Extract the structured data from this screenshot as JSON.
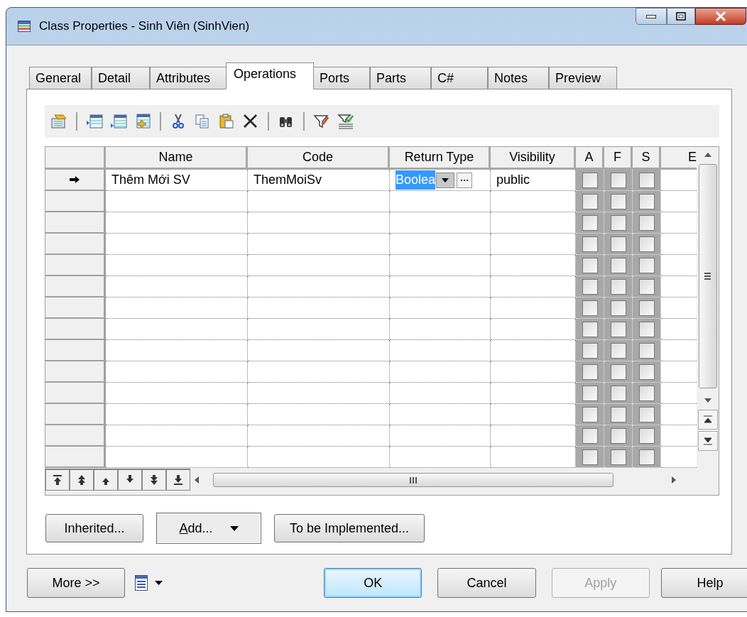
{
  "window": {
    "title": "Class Properties - Sinh Viên (SinhVien)"
  },
  "tabs": [
    {
      "label": "General",
      "selected": false
    },
    {
      "label": "Detail",
      "selected": false
    },
    {
      "label": "Attributes",
      "selected": false
    },
    {
      "label": "Operations",
      "selected": true
    },
    {
      "label": "Ports",
      "selected": false
    },
    {
      "label": "Parts",
      "selected": false
    },
    {
      "label": "C#",
      "selected": false
    },
    {
      "label": "Notes",
      "selected": false
    },
    {
      "label": "Preview",
      "selected": false
    }
  ],
  "grid": {
    "columns": [
      "Name",
      "Code",
      "Return Type",
      "Visibility",
      "A",
      "F",
      "S",
      "E"
    ],
    "rows": [
      {
        "selected": true,
        "name": "Thêm Mới SV",
        "code": "ThemMoiSv",
        "return_type": "Boolea",
        "editing": true,
        "visibility": "public",
        "a": false,
        "f": false,
        "s": false
      },
      {
        "selected": false,
        "a": false,
        "f": false,
        "s": false
      },
      {
        "selected": false,
        "a": false,
        "f": false,
        "s": false
      },
      {
        "selected": false,
        "a": false,
        "f": false,
        "s": false
      },
      {
        "selected": false,
        "a": false,
        "f": false,
        "s": false
      },
      {
        "selected": false,
        "a": false,
        "f": false,
        "s": false
      },
      {
        "selected": false,
        "a": false,
        "f": false,
        "s": false
      },
      {
        "selected": false,
        "a": false,
        "f": false,
        "s": false
      },
      {
        "selected": false,
        "a": false,
        "f": false,
        "s": false
      },
      {
        "selected": false,
        "a": false,
        "f": false,
        "s": false
      },
      {
        "selected": false,
        "a": false,
        "f": false,
        "s": false
      },
      {
        "selected": false,
        "a": false,
        "f": false,
        "s": false
      },
      {
        "selected": false,
        "a": false,
        "f": false,
        "s": false
      },
      {
        "selected": false,
        "a": false,
        "f": false,
        "s": false
      }
    ]
  },
  "panel_buttons": [
    {
      "label": "Inherited...",
      "kind": "plain"
    },
    {
      "label": "Add...",
      "kind": "dropdown"
    },
    {
      "label": "To be Implemented...",
      "kind": "plain"
    }
  ],
  "dialog_buttons": [
    {
      "label": "More >>",
      "disabled": false,
      "default": false
    },
    {
      "label": "OK",
      "disabled": false,
      "default": true
    },
    {
      "label": "Cancel",
      "disabled": false,
      "default": false
    },
    {
      "label": "Apply",
      "disabled": true,
      "default": false
    },
    {
      "label": "Help",
      "disabled": false,
      "default": false
    }
  ]
}
